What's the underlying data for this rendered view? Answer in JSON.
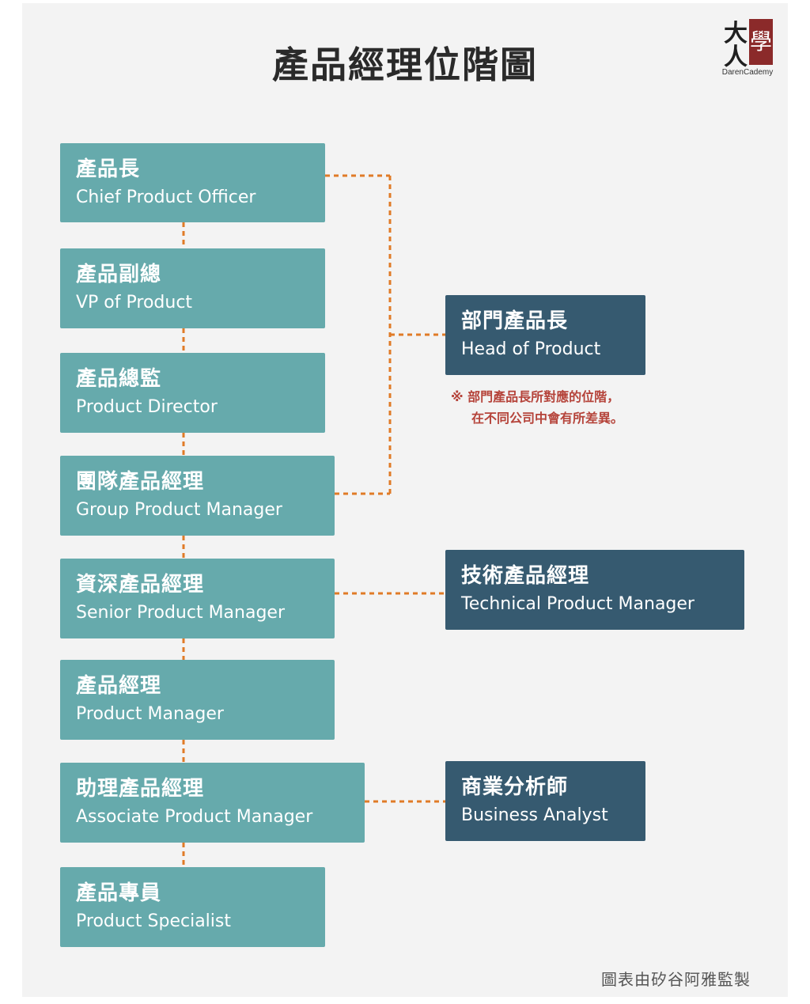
{
  "title": "產品經理位階圖",
  "logo": {
    "glyph": "大人學",
    "text": "DarenCademy",
    "color": "#8b2a2a"
  },
  "colors": {
    "teal": "#66aaac",
    "navy": "#365a70",
    "connector": "#e07b27",
    "note": "#b5433a"
  },
  "ladder": [
    {
      "zh": "產品長",
      "en": "Chief Product Officer"
    },
    {
      "zh": "產品副總",
      "en": "VP of Product"
    },
    {
      "zh": "產品總監",
      "en": "Product Director"
    },
    {
      "zh": "團隊產品經理",
      "en": "Group Product Manager"
    },
    {
      "zh": "資深產品經理",
      "en": "Senior Product Manager"
    },
    {
      "zh": "產品經理",
      "en": "Product Manager"
    },
    {
      "zh": "助理產品經理",
      "en": "Associate Product Manager"
    },
    {
      "zh": "產品專員",
      "en": "Product Specialist"
    }
  ],
  "side": [
    {
      "zh": "部門產品長",
      "en": "Head of Product"
    },
    {
      "zh": "技術產品經理",
      "en": "Technical Product Manager"
    },
    {
      "zh": "商業分析師",
      "en": "Business Analyst"
    }
  ],
  "note": {
    "line1": "※ 部門產品長所對應的位階，",
    "line2": "在不同公司中會有所差異。"
  },
  "credit": "圖表由矽谷阿雅監製"
}
